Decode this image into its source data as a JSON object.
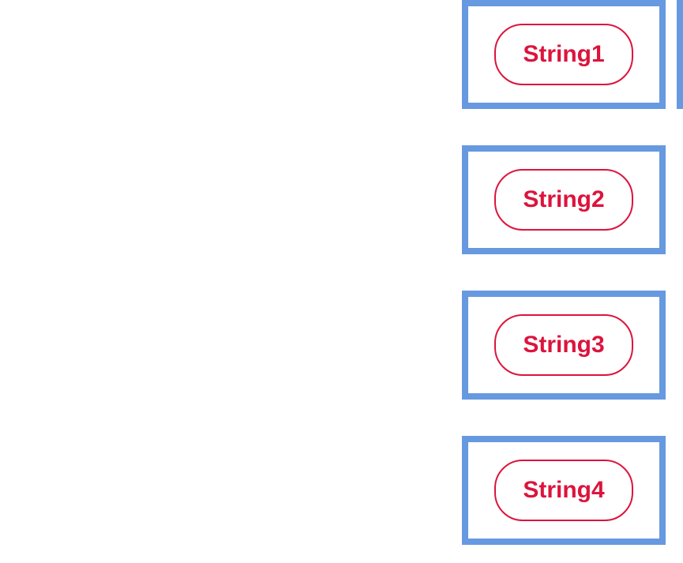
{
  "items": [
    {
      "label": "String1"
    },
    {
      "label": "String2"
    },
    {
      "label": "String3"
    },
    {
      "label": "String4"
    }
  ],
  "colors": {
    "boxBorder": "#6699e0",
    "pillBorder": "#dc143c",
    "pillText": "#dc143c"
  }
}
